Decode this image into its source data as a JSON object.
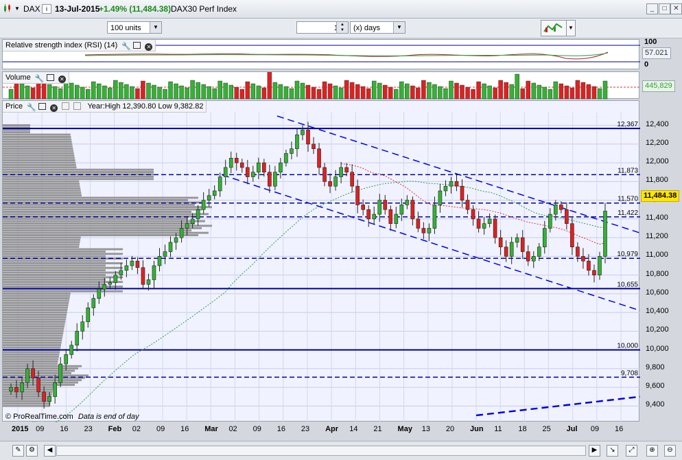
{
  "window": {
    "symbol": "DAX",
    "date": "13-Jul-2015",
    "change": "+1.49% (11,484.38)",
    "instrument": "DAX30 Perf Index",
    "info_icon": "i"
  },
  "toolbar": {
    "units_value": "100 units",
    "days_value": "1",
    "days_unit": "(x) days"
  },
  "rsi": {
    "label": "Relative strength index (RSI) (14)",
    "axis_top": "100",
    "axis_bottom": "0",
    "value": "57.021"
  },
  "volume": {
    "label": "Volume",
    "value": "445,829"
  },
  "price": {
    "label": "Price",
    "year_info": "Year:High 12,390.80 Low 9,382.82",
    "last_value": "11,484.38",
    "footer_credit": "© ProRealTime.com",
    "footer_note": "Data is end of day"
  },
  "colors": {
    "up": "#33b333",
    "down": "#e02020",
    "hline": "#000099",
    "trend": "#0000ee",
    "ma_green": "#2e9a4a",
    "ma_red": "#e03030",
    "profile": "#8c8c8c"
  },
  "chart_data": {
    "type": "candlestick",
    "x_tick_labels": [
      "2015",
      "09",
      "16",
      "23",
      "Feb",
      "02",
      "09",
      "16",
      "Mar",
      "02",
      "09",
      "16",
      "23",
      "Apr",
      "14",
      "21",
      "May",
      "13",
      "20",
      "Jun",
      "11",
      "18",
      "25",
      "Jul",
      "09",
      "16"
    ],
    "y_ticks": [
      9400,
      9600,
      9800,
      10000,
      10200,
      10400,
      10600,
      10800,
      11000,
      11200,
      11400,
      11600,
      11800,
      12000,
      12200,
      12400
    ],
    "y_range": [
      9300,
      12500
    ],
    "levels": [
      12367,
      11873,
      11570,
      11422,
      10979,
      10655,
      10000,
      9708
    ],
    "level_labels": [
      "12,367",
      "11,873",
      "11,570",
      "11,422",
      "10,979",
      "10,655",
      "10,000",
      "9,708"
    ],
    "closes": [
      9600,
      9550,
      9650,
      9800,
      9700,
      9550,
      9450,
      9500,
      9650,
      9850,
      9950,
      10050,
      10200,
      10300,
      10450,
      10550,
      10650,
      10700,
      10720,
      10800,
      10850,
      10900,
      10950,
      10880,
      10700,
      10750,
      10900,
      11000,
      11050,
      11150,
      11200,
      11300,
      11350,
      11400,
      11500,
      11600,
      11650,
      11700,
      11850,
      11950,
      12050,
      12000,
      11950,
      11850,
      11900,
      12000,
      11900,
      11750,
      11900,
      12000,
      12100,
      12150,
      12300,
      12350,
      12200,
      12150,
      11950,
      11800,
      11750,
      11850,
      11950,
      11900,
      11750,
      11550,
      11500,
      11400,
      11450,
      11600,
      11500,
      11350,
      11450,
      11550,
      11600,
      11400,
      11300,
      11250,
      11300,
      11550,
      11700,
      11750,
      11800,
      11750,
      11600,
      11500,
      11400,
      11300,
      11350,
      11400,
      11200,
      11100,
      11000,
      11150,
      11200,
      11050,
      10950,
      11000,
      11100,
      11300,
      11450,
      11550,
      11500,
      11350,
      11100,
      11000,
      10950,
      10850,
      10800,
      11000,
      11484
    ],
    "levels_note": "horizontal support/resistance lines"
  }
}
